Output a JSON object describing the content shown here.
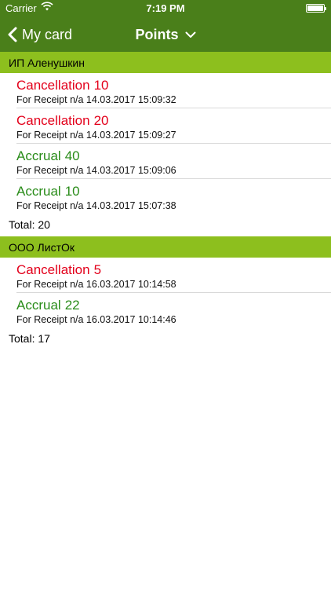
{
  "status_bar": {
    "carrier": "Carrier",
    "time": "7:19 PM"
  },
  "nav": {
    "back_label": "My card",
    "title": "Points"
  },
  "colors": {
    "nav_bar": "#4a7f1a",
    "section_header": "#8dbf1e",
    "cancellation": "#e3001b",
    "accrual": "#2a8c1a"
  },
  "sections": [
    {
      "header": "ИП Аленушкин",
      "items": [
        {
          "type": "Cancellation",
          "amount": "10",
          "detail": "For Receipt n/a 14.03.2017 15:09:32"
        },
        {
          "type": "Cancellation",
          "amount": "20",
          "detail": "For Receipt n/a 14.03.2017 15:09:27"
        },
        {
          "type": "Accrual",
          "amount": "40",
          "detail": "For Receipt n/a 14.03.2017 15:09:06"
        },
        {
          "type": "Accrual",
          "amount": "10",
          "detail": "For Receipt n/a 14.03.2017 15:07:38"
        }
      ],
      "total": "Total: 20"
    },
    {
      "header": "ООО ЛистОк",
      "items": [
        {
          "type": "Cancellation",
          "amount": "5",
          "detail": "For Receipt n/a 16.03.2017 10:14:58"
        },
        {
          "type": "Accrual",
          "amount": "22",
          "detail": "For Receipt n/a 16.03.2017 10:14:46"
        }
      ],
      "total": "Total: 17"
    }
  ]
}
